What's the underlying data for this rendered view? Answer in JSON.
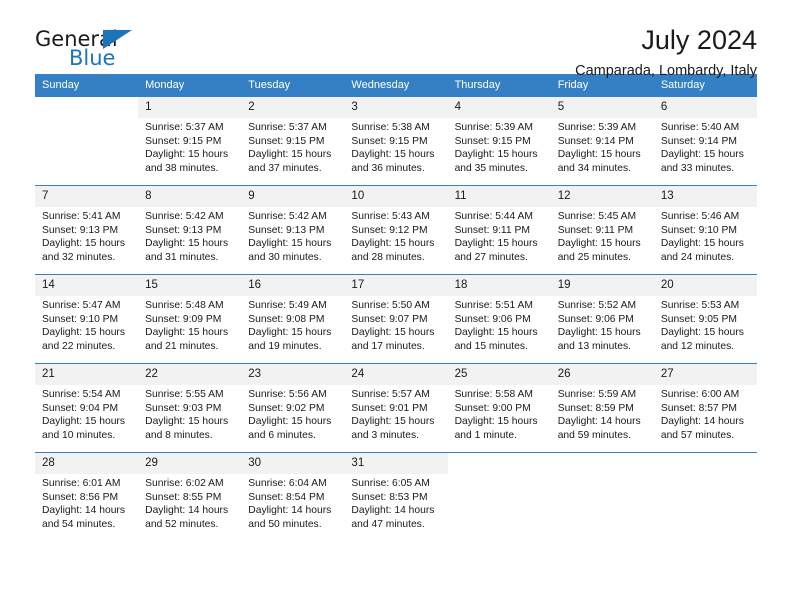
{
  "brand": {
    "line1": "General",
    "line2": "Blue",
    "accent_color": "#1e74bb"
  },
  "header": {
    "title": "July 2024",
    "subtitle": "Camparada, Lombardy, Italy"
  },
  "calendar": {
    "header_color": "#3580c4",
    "daynum_background": "#f2f2f2",
    "weekday_headers": [
      "Sunday",
      "Monday",
      "Tuesday",
      "Wednesday",
      "Thursday",
      "Friday",
      "Saturday"
    ],
    "weeks": [
      [
        {
          "day": "",
          "sunrise": "",
          "sunset": "",
          "daylight1": "",
          "daylight2": ""
        },
        {
          "day": "1",
          "sunrise": "Sunrise: 5:37 AM",
          "sunset": "Sunset: 9:15 PM",
          "daylight1": "Daylight: 15 hours",
          "daylight2": "and 38 minutes."
        },
        {
          "day": "2",
          "sunrise": "Sunrise: 5:37 AM",
          "sunset": "Sunset: 9:15 PM",
          "daylight1": "Daylight: 15 hours",
          "daylight2": "and 37 minutes."
        },
        {
          "day": "3",
          "sunrise": "Sunrise: 5:38 AM",
          "sunset": "Sunset: 9:15 PM",
          "daylight1": "Daylight: 15 hours",
          "daylight2": "and 36 minutes."
        },
        {
          "day": "4",
          "sunrise": "Sunrise: 5:39 AM",
          "sunset": "Sunset: 9:15 PM",
          "daylight1": "Daylight: 15 hours",
          "daylight2": "and 35 minutes."
        },
        {
          "day": "5",
          "sunrise": "Sunrise: 5:39 AM",
          "sunset": "Sunset: 9:14 PM",
          "daylight1": "Daylight: 15 hours",
          "daylight2": "and 34 minutes."
        },
        {
          "day": "6",
          "sunrise": "Sunrise: 5:40 AM",
          "sunset": "Sunset: 9:14 PM",
          "daylight1": "Daylight: 15 hours",
          "daylight2": "and 33 minutes."
        }
      ],
      [
        {
          "day": "7",
          "sunrise": "Sunrise: 5:41 AM",
          "sunset": "Sunset: 9:13 PM",
          "daylight1": "Daylight: 15 hours",
          "daylight2": "and 32 minutes."
        },
        {
          "day": "8",
          "sunrise": "Sunrise: 5:42 AM",
          "sunset": "Sunset: 9:13 PM",
          "daylight1": "Daylight: 15 hours",
          "daylight2": "and 31 minutes."
        },
        {
          "day": "9",
          "sunrise": "Sunrise: 5:42 AM",
          "sunset": "Sunset: 9:13 PM",
          "daylight1": "Daylight: 15 hours",
          "daylight2": "and 30 minutes."
        },
        {
          "day": "10",
          "sunrise": "Sunrise: 5:43 AM",
          "sunset": "Sunset: 9:12 PM",
          "daylight1": "Daylight: 15 hours",
          "daylight2": "and 28 minutes."
        },
        {
          "day": "11",
          "sunrise": "Sunrise: 5:44 AM",
          "sunset": "Sunset: 9:11 PM",
          "daylight1": "Daylight: 15 hours",
          "daylight2": "and 27 minutes."
        },
        {
          "day": "12",
          "sunrise": "Sunrise: 5:45 AM",
          "sunset": "Sunset: 9:11 PM",
          "daylight1": "Daylight: 15 hours",
          "daylight2": "and 25 minutes."
        },
        {
          "day": "13",
          "sunrise": "Sunrise: 5:46 AM",
          "sunset": "Sunset: 9:10 PM",
          "daylight1": "Daylight: 15 hours",
          "daylight2": "and 24 minutes."
        }
      ],
      [
        {
          "day": "14",
          "sunrise": "Sunrise: 5:47 AM",
          "sunset": "Sunset: 9:10 PM",
          "daylight1": "Daylight: 15 hours",
          "daylight2": "and 22 minutes."
        },
        {
          "day": "15",
          "sunrise": "Sunrise: 5:48 AM",
          "sunset": "Sunset: 9:09 PM",
          "daylight1": "Daylight: 15 hours",
          "daylight2": "and 21 minutes."
        },
        {
          "day": "16",
          "sunrise": "Sunrise: 5:49 AM",
          "sunset": "Sunset: 9:08 PM",
          "daylight1": "Daylight: 15 hours",
          "daylight2": "and 19 minutes."
        },
        {
          "day": "17",
          "sunrise": "Sunrise: 5:50 AM",
          "sunset": "Sunset: 9:07 PM",
          "daylight1": "Daylight: 15 hours",
          "daylight2": "and 17 minutes."
        },
        {
          "day": "18",
          "sunrise": "Sunrise: 5:51 AM",
          "sunset": "Sunset: 9:06 PM",
          "daylight1": "Daylight: 15 hours",
          "daylight2": "and 15 minutes."
        },
        {
          "day": "19",
          "sunrise": "Sunrise: 5:52 AM",
          "sunset": "Sunset: 9:06 PM",
          "daylight1": "Daylight: 15 hours",
          "daylight2": "and 13 minutes."
        },
        {
          "day": "20",
          "sunrise": "Sunrise: 5:53 AM",
          "sunset": "Sunset: 9:05 PM",
          "daylight1": "Daylight: 15 hours",
          "daylight2": "and 12 minutes."
        }
      ],
      [
        {
          "day": "21",
          "sunrise": "Sunrise: 5:54 AM",
          "sunset": "Sunset: 9:04 PM",
          "daylight1": "Daylight: 15 hours",
          "daylight2": "and 10 minutes."
        },
        {
          "day": "22",
          "sunrise": "Sunrise: 5:55 AM",
          "sunset": "Sunset: 9:03 PM",
          "daylight1": "Daylight: 15 hours",
          "daylight2": "and 8 minutes."
        },
        {
          "day": "23",
          "sunrise": "Sunrise: 5:56 AM",
          "sunset": "Sunset: 9:02 PM",
          "daylight1": "Daylight: 15 hours",
          "daylight2": "and 6 minutes."
        },
        {
          "day": "24",
          "sunrise": "Sunrise: 5:57 AM",
          "sunset": "Sunset: 9:01 PM",
          "daylight1": "Daylight: 15 hours",
          "daylight2": "and 3 minutes."
        },
        {
          "day": "25",
          "sunrise": "Sunrise: 5:58 AM",
          "sunset": "Sunset: 9:00 PM",
          "daylight1": "Daylight: 15 hours",
          "daylight2": "and 1 minute."
        },
        {
          "day": "26",
          "sunrise": "Sunrise: 5:59 AM",
          "sunset": "Sunset: 8:59 PM",
          "daylight1": "Daylight: 14 hours",
          "daylight2": "and 59 minutes."
        },
        {
          "day": "27",
          "sunrise": "Sunrise: 6:00 AM",
          "sunset": "Sunset: 8:57 PM",
          "daylight1": "Daylight: 14 hours",
          "daylight2": "and 57 minutes."
        }
      ],
      [
        {
          "day": "28",
          "sunrise": "Sunrise: 6:01 AM",
          "sunset": "Sunset: 8:56 PM",
          "daylight1": "Daylight: 14 hours",
          "daylight2": "and 54 minutes."
        },
        {
          "day": "29",
          "sunrise": "Sunrise: 6:02 AM",
          "sunset": "Sunset: 8:55 PM",
          "daylight1": "Daylight: 14 hours",
          "daylight2": "and 52 minutes."
        },
        {
          "day": "30",
          "sunrise": "Sunrise: 6:04 AM",
          "sunset": "Sunset: 8:54 PM",
          "daylight1": "Daylight: 14 hours",
          "daylight2": "and 50 minutes."
        },
        {
          "day": "31",
          "sunrise": "Sunrise: 6:05 AM",
          "sunset": "Sunset: 8:53 PM",
          "daylight1": "Daylight: 14 hours",
          "daylight2": "and 47 minutes."
        },
        {
          "day": "",
          "sunrise": "",
          "sunset": "",
          "daylight1": "",
          "daylight2": ""
        },
        {
          "day": "",
          "sunrise": "",
          "sunset": "",
          "daylight1": "",
          "daylight2": ""
        },
        {
          "day": "",
          "sunrise": "",
          "sunset": "",
          "daylight1": "",
          "daylight2": ""
        }
      ]
    ]
  }
}
